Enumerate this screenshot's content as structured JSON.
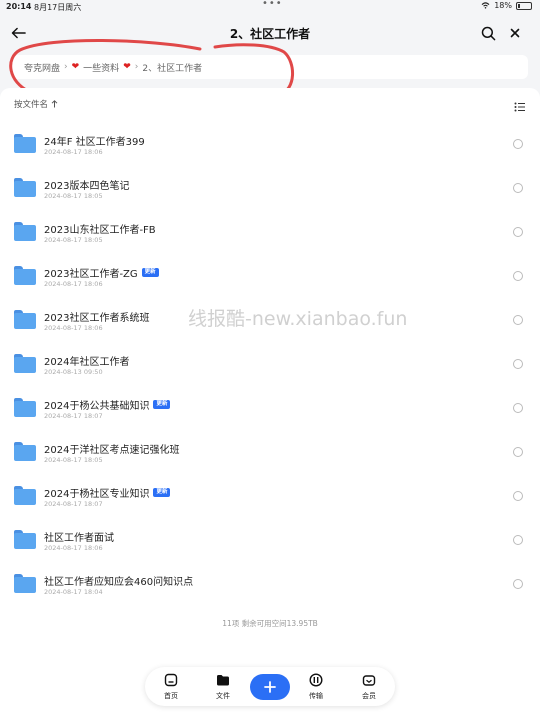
{
  "status_bar": {
    "time": "20:14",
    "date": "8月17日周六",
    "battery": "18%"
  },
  "header": {
    "title": "2、社区工作者",
    "back_icon": "arrow-left-icon",
    "search_icon": "search-icon",
    "close_icon": "close-icon"
  },
  "breadcrumb": {
    "items": [
      "夸克网盘",
      "一些资料",
      "2、社区工作者"
    ]
  },
  "sort": {
    "label": "按文件名",
    "direction_icon": "arrow-up-icon",
    "view_icon": "list-view-icon"
  },
  "files": [
    {
      "name": "24年F 社区工作者399",
      "date": "2024-08-17 18:06",
      "badge": ""
    },
    {
      "name": "2023版本四色笔记",
      "date": "2024-08-17 18:05",
      "badge": ""
    },
    {
      "name": "2023山东社区工作者-FB",
      "date": "2024-08-17 18:05",
      "badge": ""
    },
    {
      "name": "2023社区工作者-ZG",
      "date": "2024-08-17 18:06",
      "badge": "更新"
    },
    {
      "name": "2023社区工作者系统班",
      "date": "2024-08-17 18:06",
      "badge": ""
    },
    {
      "name": "2024年社区工作者",
      "date": "2024-08-13 09:50",
      "badge": ""
    },
    {
      "name": "2024于杨公共基础知识",
      "date": "2024-08-17 18:07",
      "badge": "更新"
    },
    {
      "name": "2024于洋社区考点速记强化班",
      "date": "2024-08-17 18:05",
      "badge": ""
    },
    {
      "name": "2024于杨社区专业知识",
      "date": "2024-08-17 18:07",
      "badge": "更新"
    },
    {
      "name": "社区工作者面试",
      "date": "2024-08-17 18:06",
      "badge": ""
    },
    {
      "name": "社区工作者应知应会460问知识点",
      "date": "2024-08-17 18:04",
      "badge": ""
    }
  ],
  "watermark": "线报酷-new.xianbao.fun",
  "footer": {
    "summary": "11项 剩余可用空间13.95TB"
  },
  "nav": {
    "home": "首页",
    "files": "文件",
    "transfer": "传输",
    "member": "会员"
  },
  "colors": {
    "accent": "#2b6ff5",
    "folder": "#5aa6f0",
    "annotation": "#e04848"
  }
}
